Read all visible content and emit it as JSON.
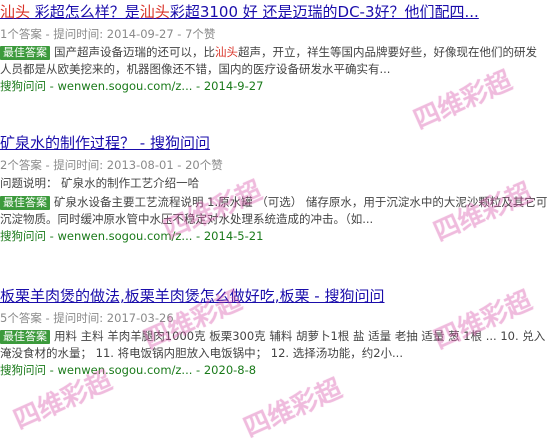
{
  "results": [
    {
      "title_parts": [
        {
          "text": "汕头",
          "hl": true
        },
        {
          "text": " 彩超怎么样？是",
          "hl": false
        },
        {
          "text": "汕头",
          "hl": true
        },
        {
          "text": "彩超3100 好 还是迈瑞的DC-3好？他们配四...",
          "hl": false
        }
      ],
      "meta": "1个答案 - 提问时间: 2014-09-27 - 7个赞",
      "best_label": "最佳答案",
      "desc_parts": [
        {
          "text": "国产超声设备迈瑞的还可以，比",
          "hl": false
        },
        {
          "text": "汕头",
          "hl": true
        },
        {
          "text": "超声，开立，祥生等国内品牌要好些，好像现在他们的研发人员都是从欧美挖来的，机器图像还不错，国内的医疗设备研发水平确实有...",
          "hl": false
        }
      ],
      "question_desc": "",
      "source_site": "搜狗问问",
      "source_url": " - wenwen.sogou.com/z...",
      "source_date": " - 2014-9-27"
    },
    {
      "title_parts": [
        {
          "text": "矿泉水的制作过程？ - 搜狗问问",
          "hl": false
        }
      ],
      "meta": "2个答案 - 提问时间: 2013-08-01 - 20个赞",
      "question_desc": "问题说明： 矿泉水的制作工艺介绍一哈",
      "best_label": "最佳答案",
      "desc_parts": [
        {
          "text": "矿泉水设备主要工艺流程说明 1.原水罐 （可选） 储存原水，用于沉淀水中的大泥沙颗粒及其它可沉淀物质。同时缓冲原水管中水压不稳定对水处理系统造成的冲击。（如...",
          "hl": false
        }
      ],
      "source_site": "搜狗问问",
      "source_url": " - wenwen.sogou.com/z...",
      "source_date": " - 2014-5-21"
    },
    {
      "title_parts": [
        {
          "text": "板栗羊肉煲的做法,板栗羊肉煲怎么做好吃,板栗 - 搜狗问问",
          "hl": false
        }
      ],
      "meta": "5个答案 - 提问时间: 2017-03-26",
      "question_desc": "",
      "best_label": "最佳答案",
      "desc_parts": [
        {
          "text": "用料 主料 羊肉羊腿肉1000克 板栗300克 辅料 胡萝卜1根 盐 适量 老抽 适量 葱 1根 ... 10. 兑入淹没食材的水量； 11. 将电饭锅内胆放入电饭锅中； 12. 选择汤功能，约2小...",
          "hl": false
        }
      ],
      "source_site": "搜狗问问",
      "source_url": " - wenwen.sogou.com/z...",
      "source_date": " - 2020-8-8"
    }
  ],
  "watermark_text": "四维彩超",
  "colors": {
    "link": "#1a0dab",
    "highlight": "#d93025",
    "best_badge": "#3c9a3c",
    "source": "#1a7a1a",
    "watermark": "#d650aa"
  }
}
